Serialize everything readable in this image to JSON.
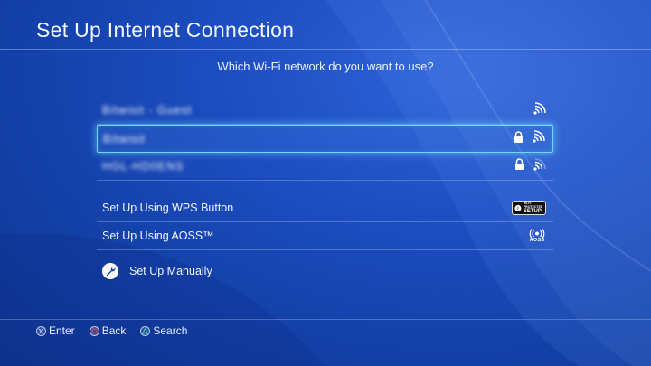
{
  "header": {
    "title": "Set Up Internet Connection",
    "subtitle": "Which Wi-Fi network do you want to use?"
  },
  "networks": [
    {
      "ssid": "Bitwisit - Guest",
      "secured": false,
      "signal": "strong",
      "selected": false
    },
    {
      "ssid": "Bitwisit",
      "secured": true,
      "signal": "strong",
      "selected": true
    },
    {
      "ssid": "HGL-HD0ENS",
      "secured": true,
      "signal": "medium",
      "selected": false
    }
  ],
  "options": {
    "wps_label": "Set Up Using WPS Button",
    "wps_badge_line1": "WI-FI PROTECTED",
    "wps_badge_line2": "SETUP",
    "aoss_label": "Set Up Using AOSS™",
    "aoss_badge": "AOSS",
    "manual_label": "Set Up Manually"
  },
  "footer": {
    "enter": "Enter",
    "back": "Back",
    "search": "Search"
  },
  "icons": {
    "wifi": "wifi-signal-icon",
    "lock": "lock-icon",
    "wrench": "wrench-icon",
    "cross": "cross-button-icon",
    "circle": "circle-button-icon",
    "triangle": "triangle-button-icon"
  },
  "colors": {
    "background": "#1d4ec2",
    "selection_glow": "#6fd6ff",
    "circle_button": "#e2414f",
    "triangle_button": "#3fc9a0"
  }
}
